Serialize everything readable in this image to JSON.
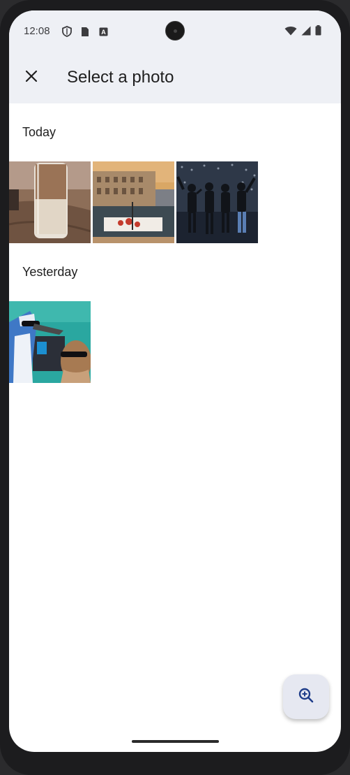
{
  "status_bar": {
    "time": "12:08",
    "left_icons": [
      "shield-icon",
      "sim-card-icon",
      "translate-icon"
    ],
    "right_icons": [
      "wifi-icon",
      "cell-signal-icon",
      "battery-icon"
    ]
  },
  "app_bar": {
    "close_icon": "close-icon",
    "title": "Select a photo"
  },
  "sections": [
    {
      "title": "Today",
      "photos": [
        {
          "name": "iced-latte-photo"
        },
        {
          "name": "colosseum-dinner-photo"
        },
        {
          "name": "band-on-stage-photo"
        }
      ]
    },
    {
      "title": "Yesterday",
      "photos": [
        {
          "name": "cartoon-characters-photo"
        }
      ]
    }
  ],
  "fab": {
    "icon": "zoom-in-icon"
  },
  "colors": {
    "bar_background": "#eef0f5",
    "fab_background": "#e6e8f1",
    "icon_accent": "#1f3d8a"
  }
}
